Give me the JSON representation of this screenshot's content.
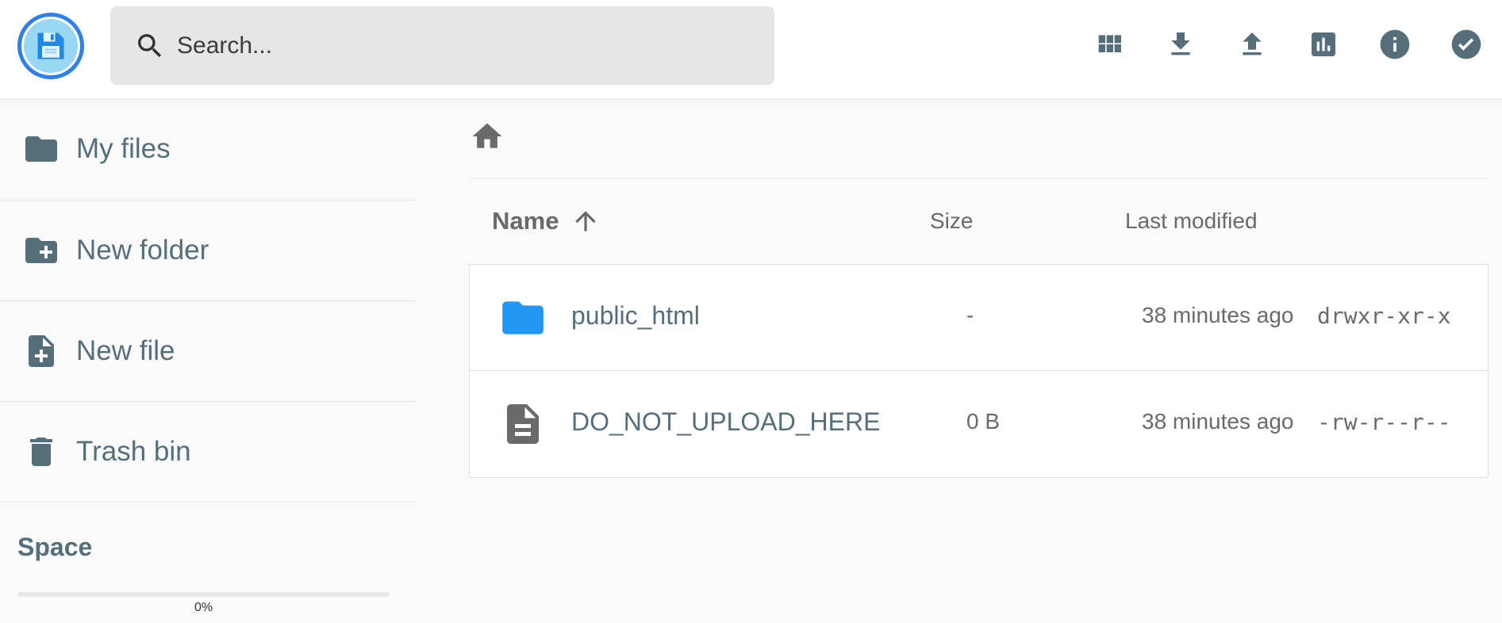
{
  "header": {
    "logo_icon": "floppy-disk-logo-icon",
    "search": {
      "placeholder": "Search..."
    },
    "actions": [
      {
        "name": "grid-view-icon"
      },
      {
        "name": "download-icon"
      },
      {
        "name": "upload-icon"
      },
      {
        "name": "stats-icon"
      },
      {
        "name": "info-icon"
      },
      {
        "name": "check-circle-icon"
      }
    ]
  },
  "sidebar": {
    "items": [
      {
        "label": "My files",
        "icon": "folder-icon"
      },
      {
        "label": "New folder",
        "icon": "folder-plus-icon"
      },
      {
        "label": "New file",
        "icon": "file-plus-icon"
      },
      {
        "label": "Trash bin",
        "icon": "trash-icon"
      }
    ],
    "space": {
      "title": "Space",
      "percent_text": "0%",
      "used_fraction": 0.0
    }
  },
  "breadcrumb": {
    "icon": "home-icon"
  },
  "table": {
    "columns": {
      "name": "Name",
      "size": "Size",
      "modified": "Last modified"
    },
    "sort_icon": "arrow-up-icon",
    "rows": [
      {
        "type": "folder",
        "name": "public_html",
        "size": "-",
        "modified": "38 minutes ago",
        "permissions": "drwxr-xr-x"
      },
      {
        "type": "file",
        "name": "DO_NOT_UPLOAD_HERE",
        "size": "0 B",
        "modified": "38 minutes ago",
        "permissions": "-rw-r--r--"
      }
    ]
  },
  "colors": {
    "accent": "#2196f3",
    "logo_border": "#2f80ed",
    "icon_dark": "#546e7a",
    "icon_grey": "#6a6a6a"
  }
}
